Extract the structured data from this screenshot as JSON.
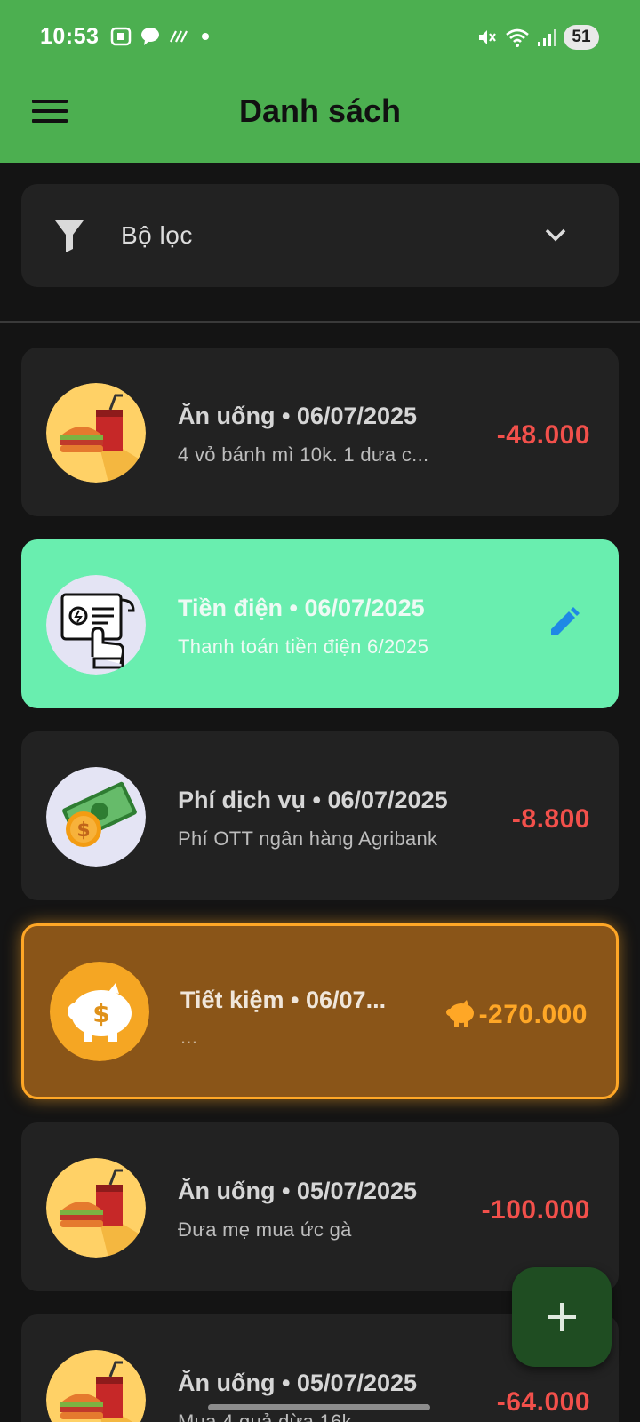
{
  "status_bar": {
    "time": "10:53",
    "battery": "51"
  },
  "app_bar": {
    "title": "Danh sách"
  },
  "filter": {
    "label": "Bộ lọc"
  },
  "transactions": [
    {
      "title": "Ăn uống • 06/07/2025",
      "subtitle": "4 vỏ bánh mì 10k. 1 dưa c...",
      "amount": "-48.000",
      "icon": "food-drink-icon"
    },
    {
      "title": "Tiền điện • 06/07/2025",
      "subtitle": "Thanh toán tiền điện 6/2025",
      "amount": "",
      "icon": "electric-bill-icon"
    },
    {
      "title": "Phí dịch vụ • 06/07/2025",
      "subtitle": "Phí OTT ngân hàng Agribank",
      "amount": "-8.800",
      "icon": "money-icon"
    },
    {
      "title": "Tiết kiệm • 06/07...",
      "subtitle": "...",
      "amount": "-270.000",
      "icon": "piggy-bank-icon"
    },
    {
      "title": "Ăn uống • 05/07/2025",
      "subtitle": "Đưa mẹ mua ức gà",
      "amount": "-100.000",
      "icon": "food-drink-icon"
    },
    {
      "title": "Ăn uống • 05/07/2025",
      "subtitle": "Mua 4 quả dừa 16k",
      "amount": "-64.000",
      "icon": "food-drink-icon"
    }
  ],
  "colors": {
    "app_bar": "#4CAF50",
    "selected_card": "#69EEAF",
    "savings_card": "#8A5518",
    "savings_accent": "#FFA726",
    "expense_amount": "#F2504B",
    "fab": "#1F4D22"
  }
}
